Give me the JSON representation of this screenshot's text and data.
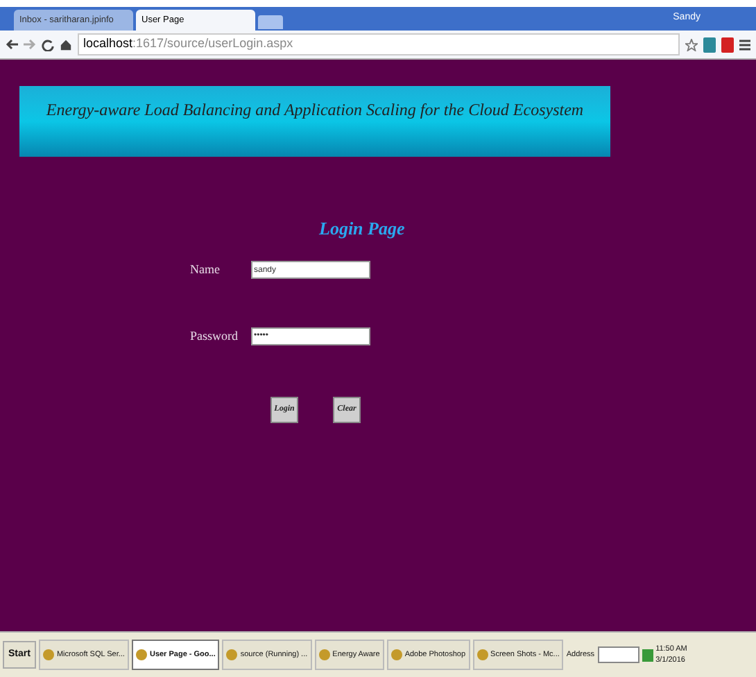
{
  "browser": {
    "tabs": [
      {
        "label": "Inbox - saritharan.jpinfo",
        "selected": false
      },
      {
        "label": "User Page",
        "selected": true
      }
    ],
    "user": "Sandy",
    "url_host": "localhost",
    "url_path": ":1617/source/userLogin.aspx"
  },
  "banner": {
    "title": "Energy-aware Load Balancing and Application Scaling for the Cloud Ecosystem"
  },
  "form": {
    "title": "Login Page",
    "fields": [
      {
        "label": "Name",
        "value": "sandy"
      },
      {
        "label": "Password",
        "value": "•••••"
      }
    ],
    "buttons": [
      "Login",
      "Clear"
    ]
  },
  "taskbar": {
    "start": "Start",
    "items": [
      {
        "label": "Microsoft SQL Ser...",
        "selected": false
      },
      {
        "label": "User Page - Goo...",
        "selected": true
      },
      {
        "label": "source (Running) ...",
        "selected": false
      },
      {
        "label": "Energy Aware",
        "selected": false
      },
      {
        "label": "Adobe Photoshop",
        "selected": false
      },
      {
        "label": "Screen Shots - Mc...",
        "selected": false
      }
    ],
    "address_label": "Address",
    "time": "11:50 AM",
    "date": "3/1/2016"
  }
}
